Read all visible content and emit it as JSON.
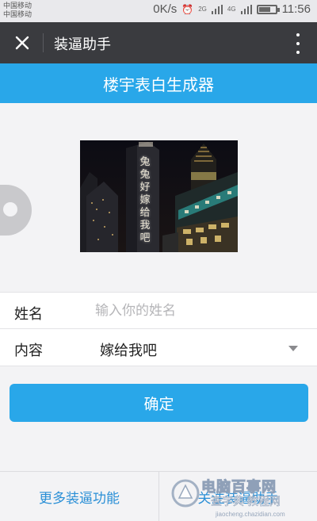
{
  "status_bar": {
    "carrier_1": "中国移动",
    "carrier_2": "中国移动",
    "network_speed": "0K/s",
    "network_type": "4G",
    "network_type_2": "2G",
    "time": "11:56",
    "battery_level": 0.7
  },
  "app_bar": {
    "title": "装逼助手"
  },
  "banner": {
    "title": "楼宇表白生成器"
  },
  "preview": {
    "building_text": "兔兔好嫁给我吧"
  },
  "form": {
    "name_label": "姓名",
    "name_placeholder": "输入你的姓名",
    "name_value": "",
    "content_label": "内容",
    "content_value": "嫁给我吧"
  },
  "confirm_label": "确定",
  "bottom_bar": {
    "left_label": "更多装逼功能",
    "right_label": "关注装逼助手"
  },
  "watermark": {
    "main": "电脑百事网",
    "sub": "查字典 教程网",
    "url": "jiaocheng.chazidian.com"
  },
  "colors": {
    "accent": "#29a7e9",
    "app_bar": "#3a3b3f",
    "link": "#2a8fd6"
  }
}
